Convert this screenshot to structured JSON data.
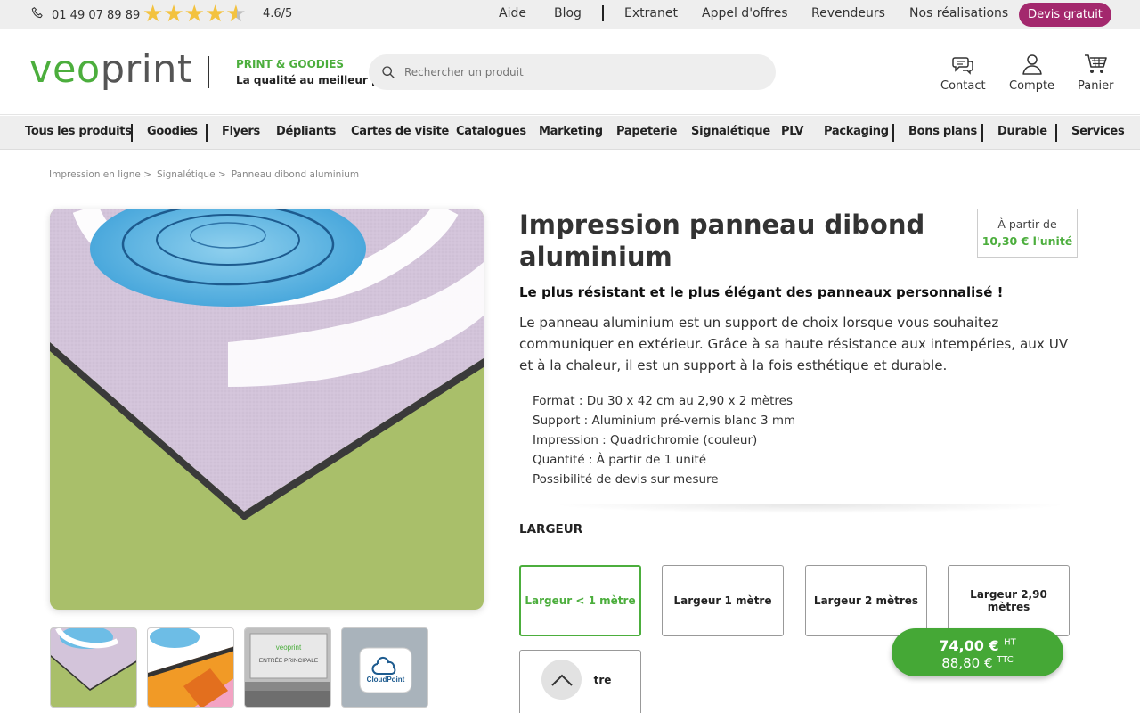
{
  "topbar": {
    "phone": "01 49 07 89 89",
    "rating": "4.6/5",
    "rating_value": 4.6,
    "links": [
      "Aide",
      "Blog",
      "Extranet",
      "Appel d'offres",
      "Revendeurs",
      "Nos réalisations"
    ],
    "cta": "Devis gratuit"
  },
  "header": {
    "logo_veo": "veo",
    "logo_print": "print",
    "tagline_1": "PRINT & GOODIES",
    "tagline_2": "La qualité au meilleur prix",
    "search_placeholder": "Rechercher un produit",
    "contact": "Contact",
    "account": "Compte",
    "cart": "Panier"
  },
  "nav": [
    "Tous les produits",
    "Goodies",
    "Flyers",
    "Dépliants",
    "Cartes de visite",
    "Catalogues",
    "Marketing",
    "Papeterie",
    "Signalétique",
    "PLV",
    "Packaging",
    "Bons plans",
    "Durable",
    "Services"
  ],
  "breadcrumb": [
    "Impression en ligne >",
    "Signalétique >",
    "Panneau dibond aluminium"
  ],
  "product": {
    "title": "Impression panneau dibond aluminium",
    "price_from_label": "À partir de",
    "price_from_value": "10,30 € l'unité",
    "subtitle": "Le plus résistant et le plus élégant des panneaux personnalisé !",
    "description": "Le panneau aluminium est un support de choix lorsque vous souhaitez communiquer en extérieur. Grâce à sa haute résistance aux intempéries, aux UV et à la chaleur, il est un support à la fois esthétique et durable.",
    "specs": [
      "Format : Du 30 x 42 cm au 2,90 x 2 mètres",
      "Support : Aluminium pré-vernis blanc 3 mm",
      "Impression : Quadrichromie (couleur)",
      "Quantité : À partir de 1 unité",
      "Possibilité de devis sur mesure"
    ],
    "width_label": "LARGEUR",
    "width_options": [
      "Largeur < 1 mètre",
      "Largeur 1 mètre",
      "Largeur 2 mètres",
      "Largeur 2,90 mètres"
    ],
    "width_extra_option_visible": "tre",
    "thumb_brand": "veoprint",
    "thumb_sign": "ENTRÉE PRINCIPALE",
    "thumb_logo": "CloudPoint"
  },
  "price": {
    "ht": "74,00 €",
    "ht_suffix": "HT",
    "ttc": "88,80 €",
    "ttc_suffix": "TTC"
  },
  "colors": {
    "brand_green": "#4cae3d",
    "cta_magenta": "#a3286d",
    "star": "#f3c23f"
  }
}
